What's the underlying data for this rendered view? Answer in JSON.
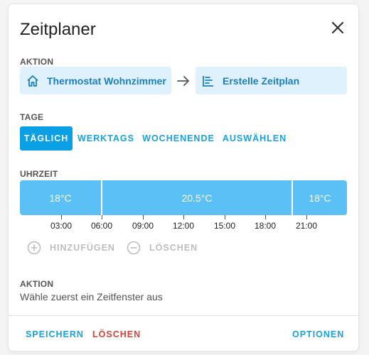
{
  "dialog": {
    "title": "Zeitplaner"
  },
  "aktion": {
    "label": "AKTION",
    "entity": "Thermostat Wohnzimmer",
    "target": "Erstelle Zeitplan"
  },
  "tage": {
    "label": "TAGE",
    "options": [
      "TÄGLICH",
      "WERKTAGS",
      "WOCHENENDE",
      "AUSWÄHLEN"
    ],
    "selected": "TÄGLICH"
  },
  "uhrzeit": {
    "label": "UHRZEIT",
    "slots": [
      "18°C",
      "20.5°C",
      "18°C"
    ],
    "ticks": [
      "03:00",
      "06:00",
      "09:00",
      "12:00",
      "15:00",
      "18:00",
      "21:00"
    ],
    "add_label": "HINZUFÜGEN",
    "delete_label": "LÖSCHEN"
  },
  "slot_action": {
    "label": "AKTION",
    "hint": "Wähle zuerst ein Zeitfenster aus"
  },
  "footer": {
    "save": "SPEICHERN",
    "delete": "LÖSCHEN",
    "options": "OPTIONEN"
  },
  "colors": {
    "accent": "#0aa0e6",
    "chip_bg": "#dff1fd",
    "slot": "#5ac0f5",
    "danger": "#d0453a",
    "disabled": "#bdbdbd"
  },
  "icons": {
    "close": "close-icon",
    "home": "home-icon",
    "arrow": "arrow-right-icon",
    "schedule": "schedule-list-icon",
    "add": "add-circle-icon",
    "remove": "remove-circle-icon"
  }
}
